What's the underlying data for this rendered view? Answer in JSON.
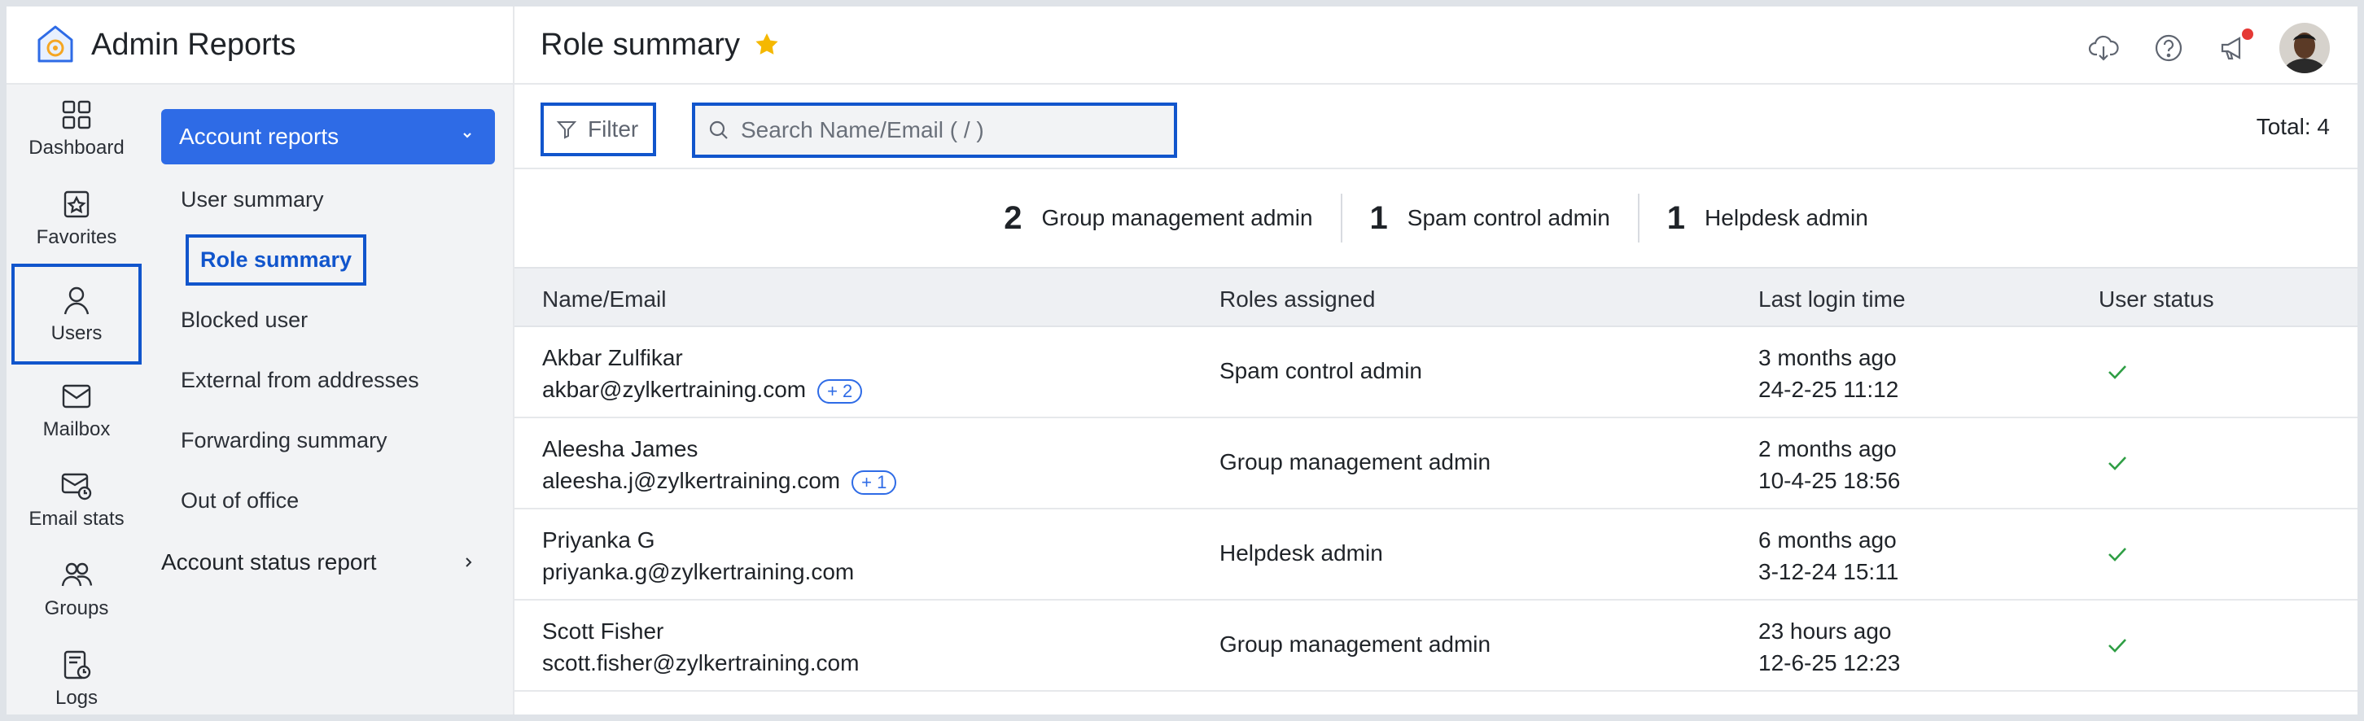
{
  "app": {
    "title": "Admin Reports"
  },
  "rail": [
    {
      "label": "Dashboard",
      "icon": "dashboard-icon"
    },
    {
      "label": "Favorites",
      "icon": "favorites-icon"
    },
    {
      "label": "Users",
      "icon": "user-icon",
      "selected": true
    },
    {
      "label": "Mailbox",
      "icon": "mailbox-icon"
    },
    {
      "label": "Email stats",
      "icon": "email-stats-icon"
    },
    {
      "label": "Groups",
      "icon": "groups-icon"
    },
    {
      "label": "Logs",
      "icon": "logs-icon"
    }
  ],
  "subnav": {
    "group_label": "Account reports",
    "links": [
      {
        "label": "User summary"
      },
      {
        "label": "Role summary",
        "active": true
      },
      {
        "label": "Blocked user"
      },
      {
        "label": "External from addresses"
      },
      {
        "label": "Forwarding summary"
      },
      {
        "label": "Out of office"
      }
    ],
    "section_label": "Account status report"
  },
  "header": {
    "title": "Role summary",
    "favorite": true
  },
  "toolbar": {
    "filter_label": "Filter",
    "search_placeholder": "Search Name/Email ( / )",
    "search_value": "",
    "total_text": "Total: 4"
  },
  "summary": [
    {
      "count": "2",
      "label": "Group management admin"
    },
    {
      "count": "1",
      "label": "Spam control admin"
    },
    {
      "count": "1",
      "label": "Helpdesk admin"
    }
  ],
  "table": {
    "columns": [
      "Name/Email",
      "Roles assigned",
      "Last login time",
      "User status"
    ],
    "rows": [
      {
        "name": "Akbar Zulfikar",
        "email": "akbar@zylkertraining.com",
        "extra_roles": "+ 2",
        "role": "Spam control admin",
        "login_relative": "3 months ago",
        "login_time": "24-2-25 11:12",
        "status": "active"
      },
      {
        "name": "Aleesha James",
        "email": "aleesha.j@zylkertraining.com",
        "extra_roles": "+ 1",
        "role": "Group management admin",
        "login_relative": "2 months ago",
        "login_time": "10-4-25 18:56",
        "status": "active"
      },
      {
        "name": "Priyanka G",
        "email": "priyanka.g@zylkertraining.com",
        "extra_roles": "",
        "role": "Helpdesk admin",
        "login_relative": "6 months ago",
        "login_time": "3-12-24 15:11",
        "status": "active"
      },
      {
        "name": "Scott Fisher",
        "email": "scott.fisher@zylkertraining.com",
        "extra_roles": "",
        "role": "Group management admin",
        "login_relative": "23 hours ago",
        "login_time": "12-6-25 12:23",
        "status": "active"
      }
    ]
  },
  "colors": {
    "accent": "#2e6be6",
    "focus_outline": "#1155cc",
    "star": "#f5b800",
    "check": "#2e9e44",
    "notification": "#e53935"
  }
}
